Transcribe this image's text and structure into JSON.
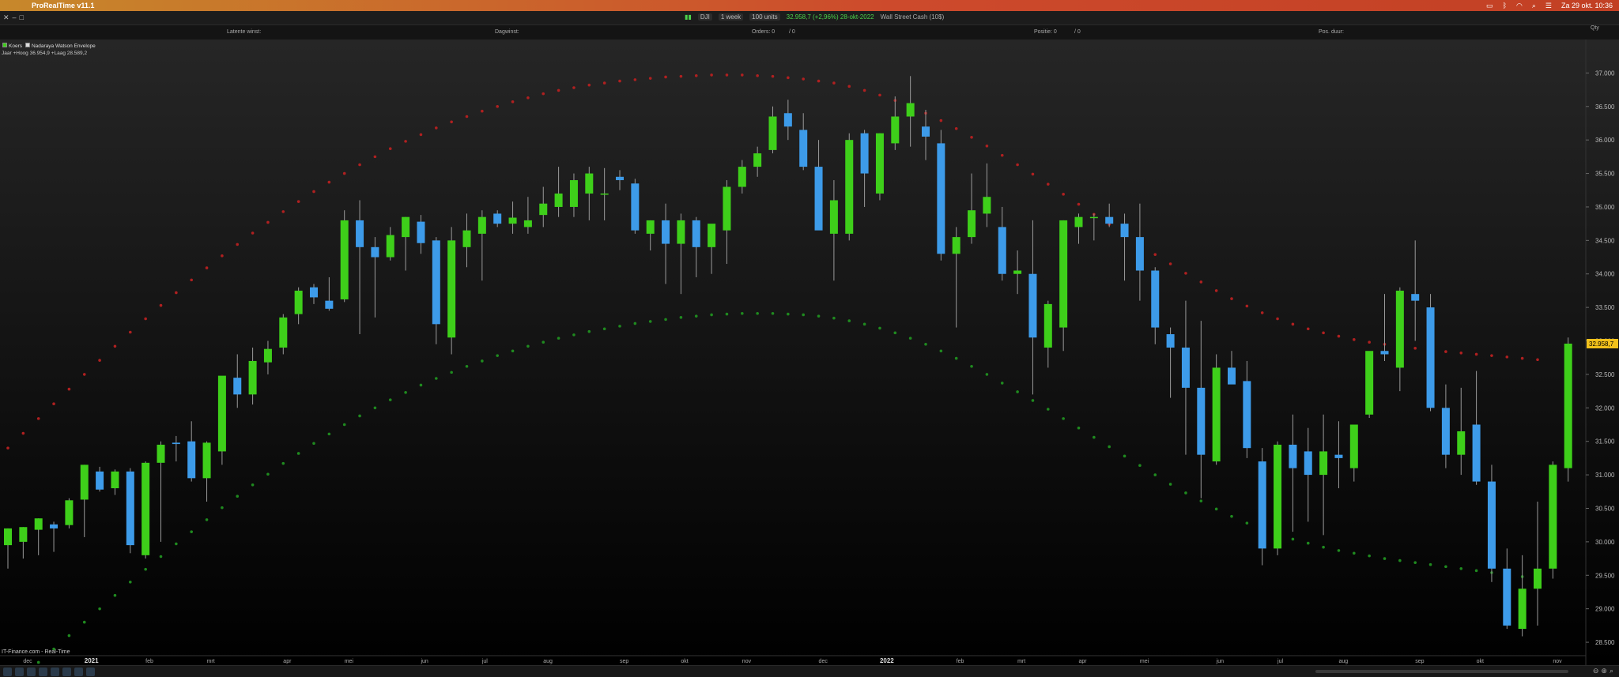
{
  "menubar": {
    "app_title": "ProRealTime v11.1",
    "clock": "Za 29 okt. 10:36"
  },
  "toolbar": {
    "instrument": "DJI",
    "timeframe": "1 week",
    "units": "100 units",
    "price": "32.958,7 (+2,96%) 28-okt-2022",
    "market": "Wall Street Cash (10$)"
  },
  "statusbar": {
    "latent": "Latente winst:",
    "daily": "Dagwinst:",
    "orders": "Orders: 0",
    "orders_sep": "/ 0",
    "position": "Positie: 0",
    "position_sep": "/ 0",
    "duration": "Pos. duur:",
    "qty": "Qty"
  },
  "legend": {
    "series1": "Koers",
    "series2": "Nadaraya Watson Envelope"
  },
  "info": "Jaar +Hoog 36.954,9 +Laag 28.589,2",
  "source": "IT-Finance.com - Real-Time",
  "colors": {
    "up": "#3ecf1a",
    "down": "#3d9be9",
    "upper_env": "#b02020",
    "lower_env": "#1f8a1f"
  },
  "chart_data": {
    "type": "candlestick",
    "price_tag": "32.958,7",
    "ylim": [
      28300,
      37500
    ],
    "y_ticks": [
      {
        "v": 28500,
        "label": "28.500"
      },
      {
        "v": 29000,
        "label": "29.000"
      },
      {
        "v": 29500,
        "label": "29.500"
      },
      {
        "v": 30000,
        "label": "30.000"
      },
      {
        "v": 30500,
        "label": "30.500"
      },
      {
        "v": 31000,
        "label": "31.000"
      },
      {
        "v": 31500,
        "label": "31.500"
      },
      {
        "v": 32000,
        "label": "32.000"
      },
      {
        "v": 32500,
        "label": "32.500"
      },
      {
        "v": 33000,
        "label": "33.000"
      },
      {
        "v": 33500,
        "label": "33.500"
      },
      {
        "v": 34000,
        "label": "34.000"
      },
      {
        "v": 34500,
        "label": "34.500"
      },
      {
        "v": 35000,
        "label": "35.000"
      },
      {
        "v": 35500,
        "label": "35.500"
      },
      {
        "v": 36000,
        "label": "36.000"
      },
      {
        "v": 36500,
        "label": "36.500"
      },
      {
        "v": 37000,
        "label": "37.000"
      }
    ],
    "x_labels": [
      {
        "i": 1,
        "label": "dec"
      },
      {
        "i": 5,
        "label": "2021"
      },
      {
        "i": 9,
        "label": "feb"
      },
      {
        "i": 13,
        "label": "mrt"
      },
      {
        "i": 18,
        "label": "apr"
      },
      {
        "i": 22,
        "label": "mei"
      },
      {
        "i": 27,
        "label": "jun"
      },
      {
        "i": 31,
        "label": "jul"
      },
      {
        "i": 35,
        "label": "aug"
      },
      {
        "i": 40,
        "label": "sep"
      },
      {
        "i": 44,
        "label": "okt"
      },
      {
        "i": 48,
        "label": "nov"
      },
      {
        "i": 53,
        "label": "dec"
      },
      {
        "i": 57,
        "label": "2022"
      },
      {
        "i": 62,
        "label": "feb"
      },
      {
        "i": 66,
        "label": "mrt"
      },
      {
        "i": 70,
        "label": "apr"
      },
      {
        "i": 74,
        "label": "mei"
      },
      {
        "i": 79,
        "label": "jun"
      },
      {
        "i": 83,
        "label": "jul"
      },
      {
        "i": 87,
        "label": "aug"
      },
      {
        "i": 92,
        "label": "sep"
      },
      {
        "i": 96,
        "label": "okt"
      },
      {
        "i": 101,
        "label": "nov"
      }
    ],
    "candles": [
      [
        29950,
        30200,
        29600,
        30200
      ],
      [
        30000,
        30220,
        29750,
        30220
      ],
      [
        30180,
        30350,
        29800,
        30350
      ],
      [
        30260,
        30300,
        29850,
        30200
      ],
      [
        30250,
        30650,
        30200,
        30620
      ],
      [
        30630,
        31150,
        30070,
        31150
      ],
      [
        31050,
        31120,
        30750,
        30780
      ],
      [
        30800,
        31080,
        30700,
        31050
      ],
      [
        31050,
        31100,
        29830,
        29950
      ],
      [
        29800,
        31200,
        29750,
        31180
      ],
      [
        31180,
        31500,
        30000,
        31450
      ],
      [
        31480,
        31580,
        31200,
        31460
      ],
      [
        31500,
        31800,
        30900,
        30950
      ],
      [
        30950,
        31500,
        30600,
        31480
      ],
      [
        31350,
        32400,
        31150,
        32480
      ],
      [
        32450,
        32800,
        32000,
        32200
      ],
      [
        32200,
        32900,
        32050,
        32700
      ],
      [
        32680,
        33000,
        32500,
        32880
      ],
      [
        32900,
        33400,
        32800,
        33350
      ],
      [
        33400,
        33800,
        33250,
        33750
      ],
      [
        33800,
        33850,
        33550,
        33650
      ],
      [
        33600,
        33950,
        33450,
        33480
      ],
      [
        33620,
        34950,
        33580,
        34800
      ],
      [
        34800,
        35100,
        33100,
        34400
      ],
      [
        34400,
        34550,
        33350,
        34250
      ],
      [
        34250,
        34700,
        34200,
        34580
      ],
      [
        34550,
        34850,
        34050,
        34850
      ],
      [
        34780,
        34880,
        34300,
        34460
      ],
      [
        34500,
        34550,
        32950,
        33250
      ],
      [
        33050,
        34700,
        32800,
        34500
      ],
      [
        34400,
        34900,
        34100,
        34650
      ],
      [
        34600,
        34950,
        33900,
        34850
      ],
      [
        34900,
        34950,
        34700,
        34750
      ],
      [
        34750,
        35080,
        34600,
        34840
      ],
      [
        34700,
        35150,
        34600,
        34800
      ],
      [
        34880,
        35300,
        34700,
        35050
      ],
      [
        35000,
        35600,
        34850,
        35200
      ],
      [
        35000,
        35500,
        34850,
        35400
      ],
      [
        35200,
        35600,
        34800,
        35500
      ],
      [
        35200,
        35580,
        34800,
        35200
      ],
      [
        35450,
        35550,
        35250,
        35400
      ],
      [
        35350,
        35420,
        34600,
        34650
      ],
      [
        34600,
        34800,
        34350,
        34800
      ],
      [
        34800,
        35050,
        33850,
        34450
      ],
      [
        34450,
        34900,
        33700,
        34800
      ],
      [
        34800,
        34850,
        33950,
        34400
      ],
      [
        34400,
        34700,
        34000,
        34750
      ],
      [
        34650,
        35400,
        34150,
        35300
      ],
      [
        35300,
        35700,
        35200,
        35600
      ],
      [
        35600,
        35900,
        35450,
        35800
      ],
      [
        35850,
        36500,
        35800,
        36350
      ],
      [
        36400,
        36600,
        36000,
        36200
      ],
      [
        36150,
        36400,
        35550,
        35600
      ],
      [
        35600,
        36000,
        34750,
        34650
      ],
      [
        34600,
        35400,
        33900,
        35100
      ],
      [
        34600,
        36100,
        34500,
        36000
      ],
      [
        36100,
        36150,
        35000,
        35500
      ],
      [
        35200,
        36100,
        35100,
        36100
      ],
      [
        35950,
        36650,
        35850,
        36350
      ],
      [
        36350,
        36954,
        35900,
        36550
      ],
      [
        36200,
        36450,
        35700,
        36050
      ],
      [
        35950,
        36150,
        34200,
        34300
      ],
      [
        34300,
        34700,
        33200,
        34550
      ],
      [
        34550,
        35500,
        34450,
        34950
      ],
      [
        34900,
        35650,
        34700,
        35150
      ],
      [
        34700,
        35000,
        33900,
        34000
      ],
      [
        34000,
        34350,
        33700,
        34050
      ],
      [
        34000,
        34800,
        32200,
        33050
      ],
      [
        32900,
        33600,
        32600,
        33550
      ],
      [
        33200,
        34800,
        32850,
        34800
      ],
      [
        34700,
        34900,
        34450,
        34850
      ],
      [
        34850,
        34900,
        34500,
        34850
      ],
      [
        34850,
        35050,
        34700,
        34750
      ],
      [
        34750,
        34900,
        33900,
        34550
      ],
      [
        34550,
        35050,
        33600,
        34050
      ],
      [
        34050,
        34100,
        32950,
        33200
      ],
      [
        33100,
        33200,
        32150,
        32900
      ],
      [
        32900,
        33600,
        31300,
        32300
      ],
      [
        32300,
        33300,
        30650,
        31300
      ],
      [
        31200,
        32800,
        31150,
        32600
      ],
      [
        32600,
        32850,
        32400,
        32350
      ],
      [
        32400,
        32700,
        31250,
        31400
      ],
      [
        31200,
        31400,
        29650,
        29900
      ],
      [
        29900,
        31500,
        29800,
        31450
      ],
      [
        31450,
        31900,
        30150,
        31100
      ],
      [
        31350,
        31700,
        30300,
        31000
      ],
      [
        31000,
        31900,
        30100,
        31350
      ],
      [
        31300,
        31800,
        30800,
        31250
      ],
      [
        31100,
        31550,
        30900,
        31750
      ],
      [
        31900,
        32800,
        31850,
        32850
      ],
      [
        32850,
        33700,
        32700,
        32800
      ],
      [
        32600,
        33800,
        32250,
        33750
      ],
      [
        33700,
        34500,
        33000,
        33600
      ],
      [
        33500,
        33700,
        31950,
        32000
      ],
      [
        32000,
        32350,
        31100,
        31300
      ],
      [
        31300,
        32300,
        31000,
        31650
      ],
      [
        31750,
        32550,
        30850,
        30900
      ],
      [
        30900,
        31150,
        29400,
        29600
      ],
      [
        29600,
        29900,
        28700,
        28750
      ],
      [
        28700,
        29800,
        28589,
        29300
      ],
      [
        29300,
        30600,
        28750,
        29600
      ],
      [
        29600,
        31200,
        29450,
        31150
      ],
      [
        31100,
        33050,
        30900,
        32959
      ]
    ],
    "upper_envelope": [
      31400,
      31620,
      31840,
      32060,
      32280,
      32500,
      32710,
      32920,
      33130,
      33330,
      33530,
      33720,
      33910,
      34090,
      34270,
      34440,
      34610,
      34770,
      34930,
      35080,
      35230,
      35370,
      35500,
      35630,
      35750,
      35870,
      35980,
      36080,
      36180,
      36270,
      36350,
      36430,
      36500,
      36570,
      36630,
      36690,
      36740,
      36780,
      36820,
      36850,
      36880,
      36900,
      36920,
      36940,
      36950,
      36960,
      36970,
      36970,
      36970,
      36960,
      36950,
      36930,
      36910,
      36880,
      36850,
      36800,
      36740,
      36670,
      36590,
      36500,
      36400,
      36290,
      36170,
      36040,
      35910,
      35770,
      35630,
      35490,
      35340,
      35190,
      35040,
      34890,
      34740,
      34590,
      34440,
      34290,
      34150,
      34010,
      33880,
      33750,
      33630,
      33520,
      33420,
      33330,
      33250,
      33180,
      33120,
      33070,
      33020,
      32980,
      32950,
      32920,
      32890,
      32860,
      32840,
      32820,
      32800,
      32780,
      32760,
      32740,
      32720
    ],
    "lower_envelope": [
      27800,
      28000,
      28200,
      28400,
      28600,
      28800,
      29000,
      29200,
      29400,
      29590,
      29780,
      29970,
      30150,
      30330,
      30510,
      30680,
      30850,
      31010,
      31170,
      31320,
      31470,
      31610,
      31750,
      31880,
      32000,
      32120,
      32230,
      32340,
      32440,
      32530,
      32620,
      32700,
      32780,
      32850,
      32920,
      32980,
      33040,
      33090,
      33140,
      33180,
      33220,
      33260,
      33290,
      33320,
      33350,
      33370,
      33390,
      33400,
      33410,
      33410,
      33410,
      33400,
      33390,
      33370,
      33340,
      33300,
      33250,
      33190,
      33120,
      33040,
      32950,
      32850,
      32740,
      32620,
      32500,
      32370,
      32240,
      32110,
      31980,
      31840,
      31700,
      31560,
      31420,
      31280,
      31140,
      31000,
      30860,
      30730,
      30610,
      30490,
      30380,
      30280,
      30190,
      30110,
      30040,
      29980,
      29920,
      29870,
      29830,
      29790,
      29750,
      29720,
      29690,
      29660,
      29630,
      29600,
      29570,
      29540,
      29510,
      29480,
      29450
    ]
  }
}
